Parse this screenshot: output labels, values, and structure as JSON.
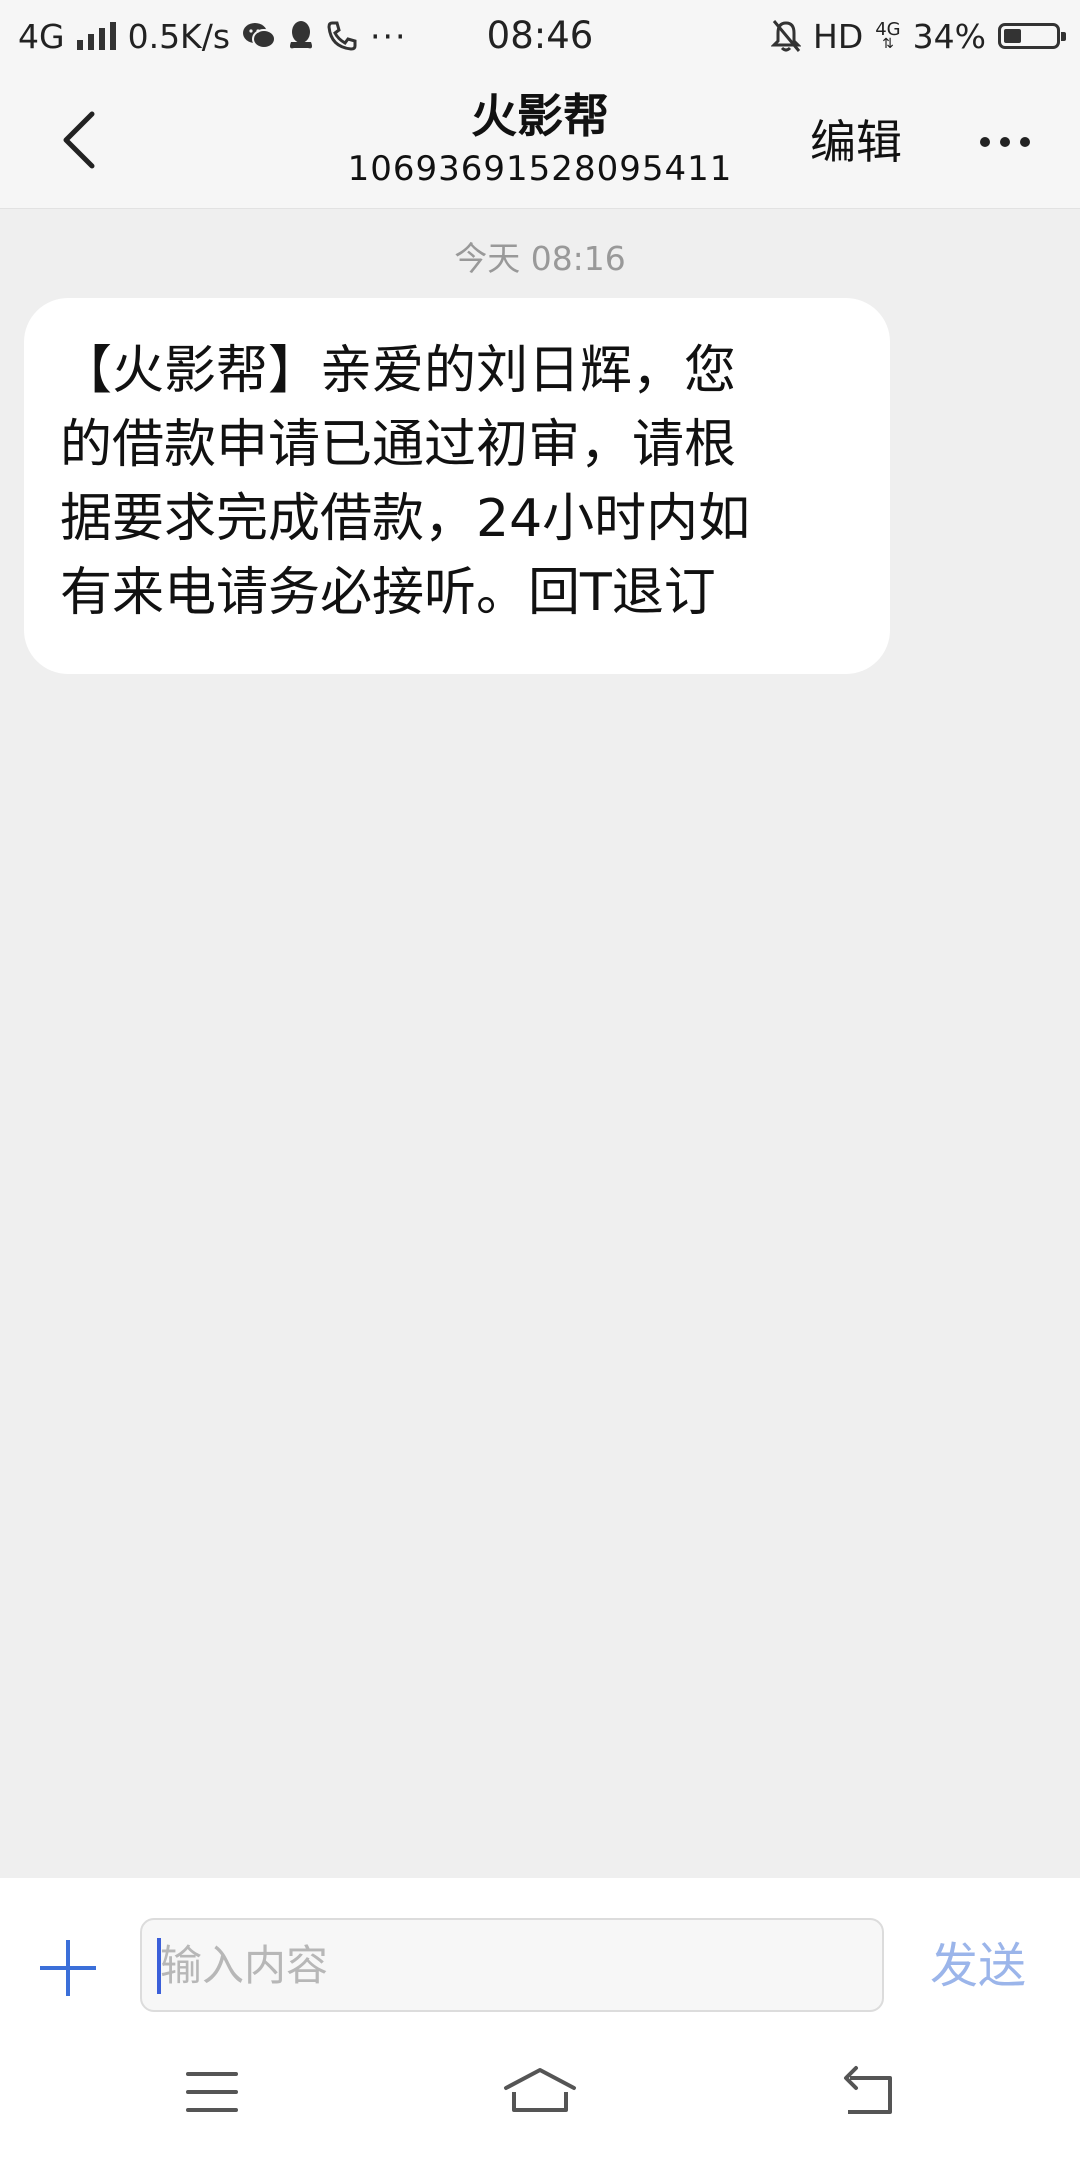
{
  "status_bar": {
    "network": "4G",
    "speed": "0.5K/s",
    "time": "08:46",
    "hd": "HD",
    "small_4g": "4G",
    "battery_percent": "34%",
    "battery_level": 0.34,
    "icons": [
      "signal-icon",
      "wechat-icon",
      "qq-icon",
      "call-icon",
      "more-notifications-icon",
      "mute-bell-icon"
    ]
  },
  "header": {
    "title": "火影帮",
    "subtitle": "10693691528095411",
    "edit_label": "编辑",
    "back_icon": "back-chevron-icon",
    "more_icon": "more-dots-icon"
  },
  "conversation": {
    "timestamp": "今天 08:16",
    "messages": [
      {
        "lines": [
          "【火影帮】亲爱的刘日辉，您",
          "的借款申请已通过初审，请根",
          "据要求完成借款，24小时内如",
          "有来电请务必接听。回T退订"
        ]
      }
    ]
  },
  "input_bar": {
    "placeholder": "输入内容",
    "value": "",
    "send_label": "发送",
    "accent_color": "#3b6fd9",
    "send_color": "#9bb5ea"
  },
  "nav_bar": {
    "icons": [
      "menu-icon",
      "home-icon",
      "back-icon"
    ]
  }
}
